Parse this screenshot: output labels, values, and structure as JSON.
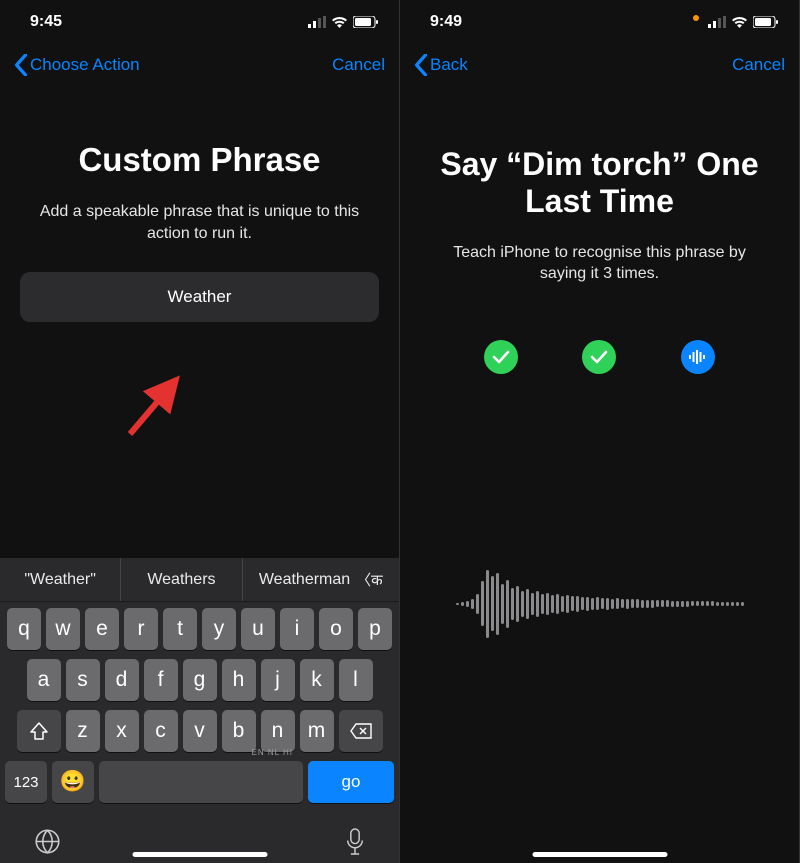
{
  "left": {
    "status": {
      "time": "9:45"
    },
    "nav": {
      "back": "Choose Action",
      "cancel": "Cancel"
    },
    "title": "Custom Phrase",
    "subtitle": "Add a speakable phrase that is unique to this action to run it.",
    "input_value": "Weather",
    "suggestions": [
      "\"Weather\"",
      "Weathers",
      "Weatherman"
    ],
    "keyboard": {
      "row1": [
        "q",
        "w",
        "e",
        "r",
        "t",
        "y",
        "u",
        "i",
        "o",
        "p"
      ],
      "row2": [
        "a",
        "s",
        "d",
        "f",
        "g",
        "h",
        "j",
        "k",
        "l"
      ],
      "row3": [
        "z",
        "x",
        "c",
        "v",
        "b",
        "n",
        "m"
      ],
      "num_key": "123",
      "go_key": "go",
      "space_hint": "EN NL HI"
    }
  },
  "right": {
    "status": {
      "time": "9:49"
    },
    "nav": {
      "back": "Back",
      "cancel": "Cancel"
    },
    "title": "Say “Dim torch” One Last Time",
    "subtitle": "Teach iPhone to recognise this phrase by saying it 3 times.",
    "progress": [
      "done",
      "done",
      "recording"
    ]
  }
}
